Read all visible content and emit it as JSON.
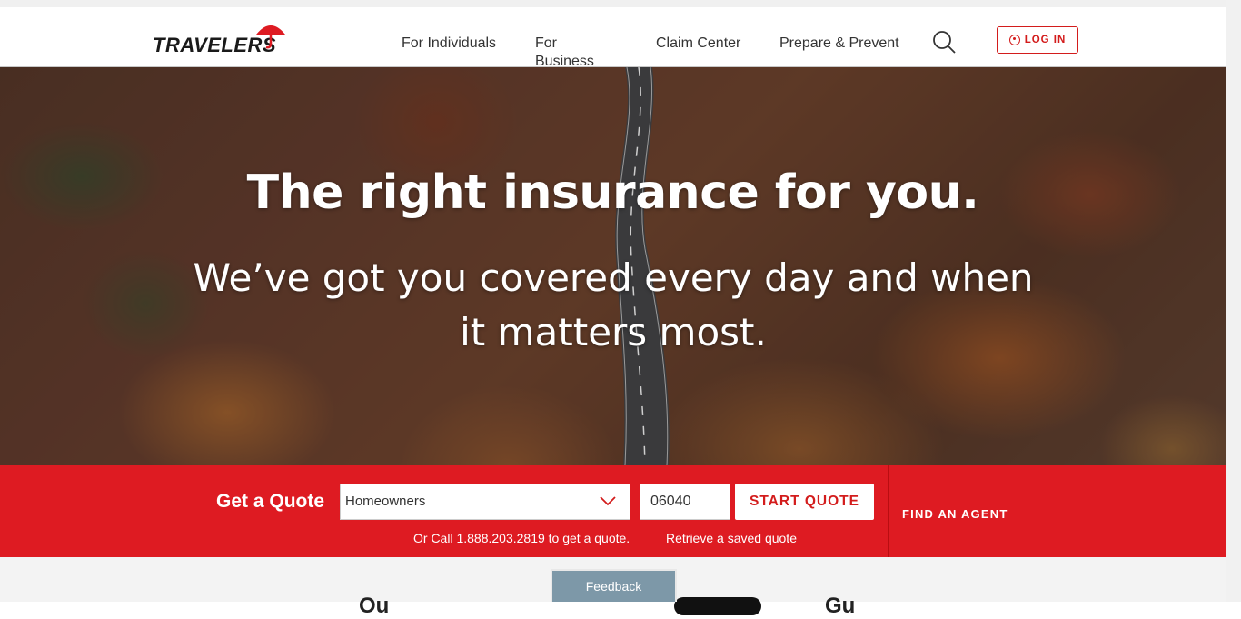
{
  "brand": {
    "logo_text": "TRAVELERS",
    "accent": "#de1b22"
  },
  "nav": {
    "items": [
      {
        "label": "For Individuals"
      },
      {
        "label": "For Business"
      },
      {
        "label": "Claim Center"
      },
      {
        "label": "Prepare & Prevent"
      }
    ],
    "search_icon": "search-icon",
    "login_label": "LOG IN"
  },
  "hero": {
    "title": "The right insurance for you.",
    "subtitle": "We’ve got you covered every day and when it matters most."
  },
  "quote": {
    "label": "Get a Quote",
    "product_selected": "Homeowners",
    "zip_value": "06040",
    "start_label": "START QUOTE",
    "call_prefix": "Or Call ",
    "phone": "1.888.203.2819",
    "call_suffix": " to get a quote.",
    "retrieve_label": "Retrieve a saved quote",
    "find_agent_label": "FIND AN AGENT"
  },
  "below": {
    "heading_left": "Ou",
    "heading_right": "Gu"
  },
  "feedback_label": "Feedback"
}
